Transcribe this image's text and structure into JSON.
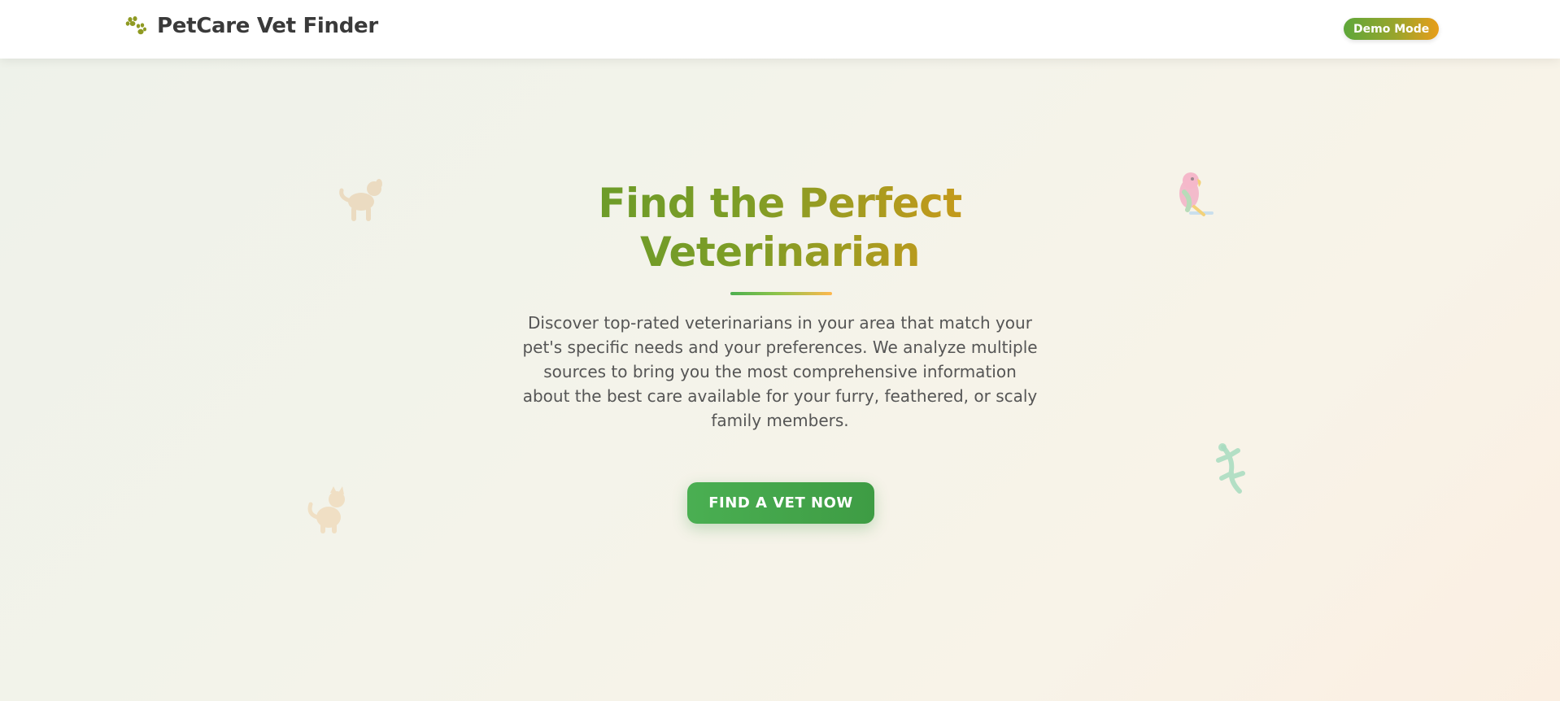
{
  "header": {
    "brand_icon": "paw-icon",
    "brand_title": "PetCare Vet Finder",
    "badge": "Demo Mode"
  },
  "hero": {
    "title_line1": "Find the Perfect",
    "title_line2": "Veterinarian",
    "description": "Discover top-rated veterinarians in your area that match your pet's specific needs and your preferences. We analyze multiple sources to bring you the most comprehensive information about the best care available for your furry, feathered, or scaly family members.",
    "cta_label": "FIND A VET NOW"
  },
  "decorations": [
    "dog-icon",
    "cat-icon",
    "parrot-icon",
    "lizard-icon"
  ],
  "colors": {
    "primary_green": "#4caf50",
    "accent_orange": "#e89d1a",
    "title_gradient_start": "#5c9a2c",
    "title_gradient_end": "#d49a18"
  }
}
